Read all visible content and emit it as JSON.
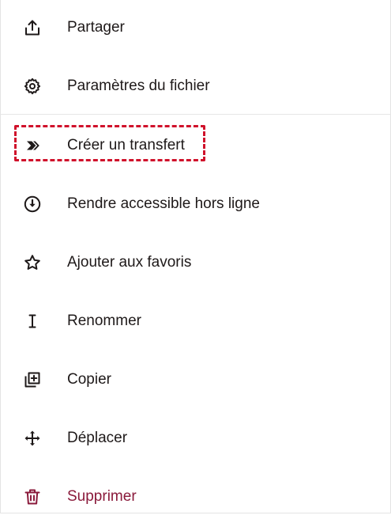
{
  "menu": {
    "items": [
      {
        "id": "share",
        "label": "Partager",
        "icon": "share-icon"
      },
      {
        "id": "file-settings",
        "label": "Paramètres du fichier",
        "icon": "gear-icon"
      },
      {
        "id": "create-transfer",
        "label": "Créer un transfert",
        "icon": "transfer-icon"
      },
      {
        "id": "make-offline",
        "label": "Rendre accessible hors ligne",
        "icon": "download-circle-icon"
      },
      {
        "id": "add-favorite",
        "label": "Ajouter aux favoris",
        "icon": "star-icon"
      },
      {
        "id": "rename",
        "label": "Renommer",
        "icon": "text-cursor-icon"
      },
      {
        "id": "copy",
        "label": "Copier",
        "icon": "copy-icon"
      },
      {
        "id": "move",
        "label": "Déplacer",
        "icon": "move-arrows-icon"
      },
      {
        "id": "delete",
        "label": "Supprimer",
        "icon": "trash-icon"
      }
    ]
  },
  "colors": {
    "text": "#1e1919",
    "danger": "#8a1a3b",
    "highlight": "#d0112b",
    "divider": "#e6e6e6"
  }
}
